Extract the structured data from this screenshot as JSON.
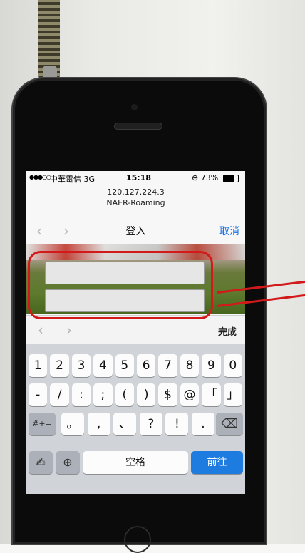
{
  "status_bar": {
    "signal": "●●●○○",
    "carrier": "中華電信 3G",
    "time": "15:18",
    "battery": "⊕ 73%"
  },
  "address": {
    "host": "120.127.224.3",
    "network": "NAER-Roaming"
  },
  "nav": {
    "back": "‹",
    "forward": "›",
    "title": "登入",
    "cancel": "取消"
  },
  "form": {
    "field1_value": "",
    "field2_value": ""
  },
  "accessory": {
    "prev": "‹",
    "next": "›",
    "done": "完成"
  },
  "keyboard": {
    "row1": [
      "1",
      "2",
      "3",
      "4",
      "5",
      "6",
      "7",
      "8",
      "9",
      "0"
    ],
    "row2": [
      "-",
      "/",
      ":",
      ";",
      "(",
      ")",
      "$",
      "@",
      "「",
      "」"
    ],
    "row3": [
      "。",
      ",",
      "、",
      "?",
      "!",
      "."
    ],
    "symbols_key": "#+=",
    "delete_icon": "backspace-icon",
    "handwriting_icon": "handwriting-icon",
    "globe_icon": "globe-icon",
    "space": "空格",
    "go": "前往"
  },
  "annotation": {
    "color": "#d21a1a"
  }
}
